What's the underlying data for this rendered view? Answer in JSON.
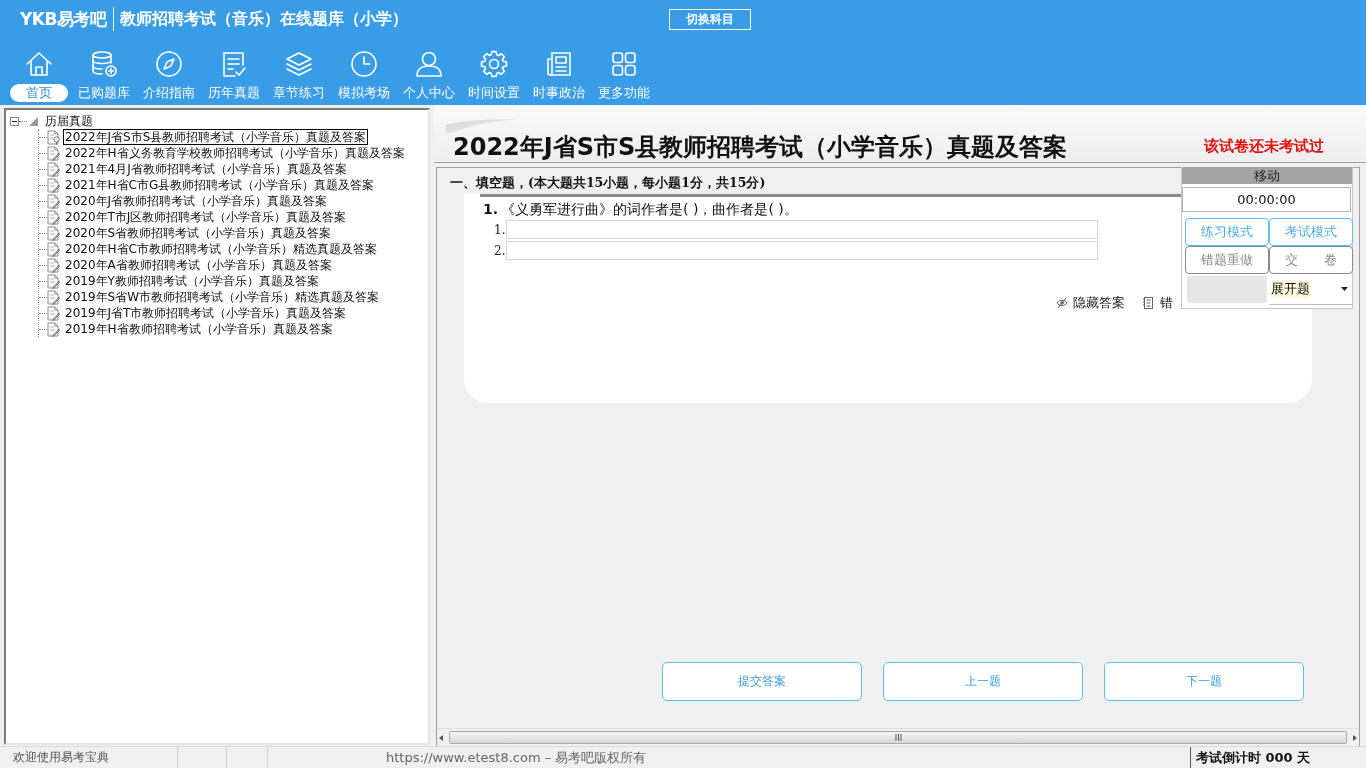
{
  "header": {
    "logo": "YKB易考吧",
    "title": "教师招聘考试（音乐）在线题库（小学）",
    "switch_button": "切换科目"
  },
  "nav": [
    {
      "label": "首页",
      "kind": "home",
      "selected": true
    },
    {
      "label": "已购题库",
      "kind": "database",
      "selected": false
    },
    {
      "label": "介绍指南",
      "kind": "compass",
      "selected": false
    },
    {
      "label": "历年真题",
      "kind": "checklist",
      "selected": false
    },
    {
      "label": "章节练习",
      "kind": "layers",
      "selected": false
    },
    {
      "label": "模拟考场",
      "kind": "clock",
      "selected": false
    },
    {
      "label": "个人中心",
      "kind": "user",
      "selected": false
    },
    {
      "label": "时间设置",
      "kind": "gear",
      "selected": false
    },
    {
      "label": "时事政治",
      "kind": "newspaper",
      "selected": false
    },
    {
      "label": "更多功能",
      "kind": "grid",
      "selected": false
    }
  ],
  "tree": {
    "label": "历届真题",
    "expanded": true,
    "children": [
      {
        "label": "2022年J省S市S县教师招聘考试（小学音乐）真题及答案",
        "selected": true
      },
      {
        "label": "2022年H省义务教育学校教师招聘考试（小学音乐）真题及答案",
        "selected": false
      },
      {
        "label": "2021年4月J省教师招聘考试（小学音乐）真题及答案",
        "selected": false
      },
      {
        "label": "2021年H省C市G县教师招聘考试（小学音乐）真题及答案",
        "selected": false
      },
      {
        "label": "2020年J省教师招聘考试（小学音乐）真题及答案",
        "selected": false
      },
      {
        "label": "2020年T市J区教师招聘考试（小学音乐）真题及答案",
        "selected": false
      },
      {
        "label": "2020年S省教师招聘考试（小学音乐）真题及答案",
        "selected": false
      },
      {
        "label": "2020年H省C市教师招聘考试（小学音乐）精选真题及答案",
        "selected": false
      },
      {
        "label": "2020年A省教师招聘考试（小学音乐）真题及答案",
        "selected": false
      },
      {
        "label": "2019年Y教师招聘考试（小学音乐）真题及答案",
        "selected": false
      },
      {
        "label": "2019年S省W市教师招聘考试（小学音乐）精选真题及答案",
        "selected": false
      },
      {
        "label": "2019年J省T市教师招聘考试（小学音乐）真题及答案",
        "selected": false
      },
      {
        "label": "2019年H省教师招聘考试（小学音乐）真题及答案",
        "selected": false
      }
    ]
  },
  "paper": {
    "title": "2022年J省S市S县教师招聘考试（小学音乐）真题及答案",
    "status": "该试卷还未考试过",
    "section": "一、填空题，(本大题共15小题，每小题1分，共15分)",
    "question": {
      "number": "1.",
      "text": "《义勇军进行曲》的词作者是( )，曲作者是( )。",
      "blanks": [
        {
          "label": "1."
        },
        {
          "label": "2."
        }
      ]
    },
    "tools": [
      {
        "kind": "hide",
        "label": "隐藏答案"
      },
      {
        "kind": "wrongbook",
        "label": "错"
      }
    ],
    "buttons": [
      "提交答案",
      "上一题",
      "下一题"
    ]
  },
  "float_panel": {
    "title": "移动",
    "timer": "00:00:00",
    "buttons": [
      {
        "label": "练习模式",
        "disabled": false
      },
      {
        "label": "考试模式",
        "disabled": false
      },
      {
        "label": "错题重做",
        "disabled": true
      },
      {
        "label": "交　　卷",
        "disabled": true
      }
    ],
    "dropdown": "展开题"
  },
  "status_bar": {
    "welcome": "欢迎使用易考宝典",
    "copyright": "https://www.etest8.com – 易考吧版权所有",
    "countdown": "考试倒计时 000 天"
  }
}
